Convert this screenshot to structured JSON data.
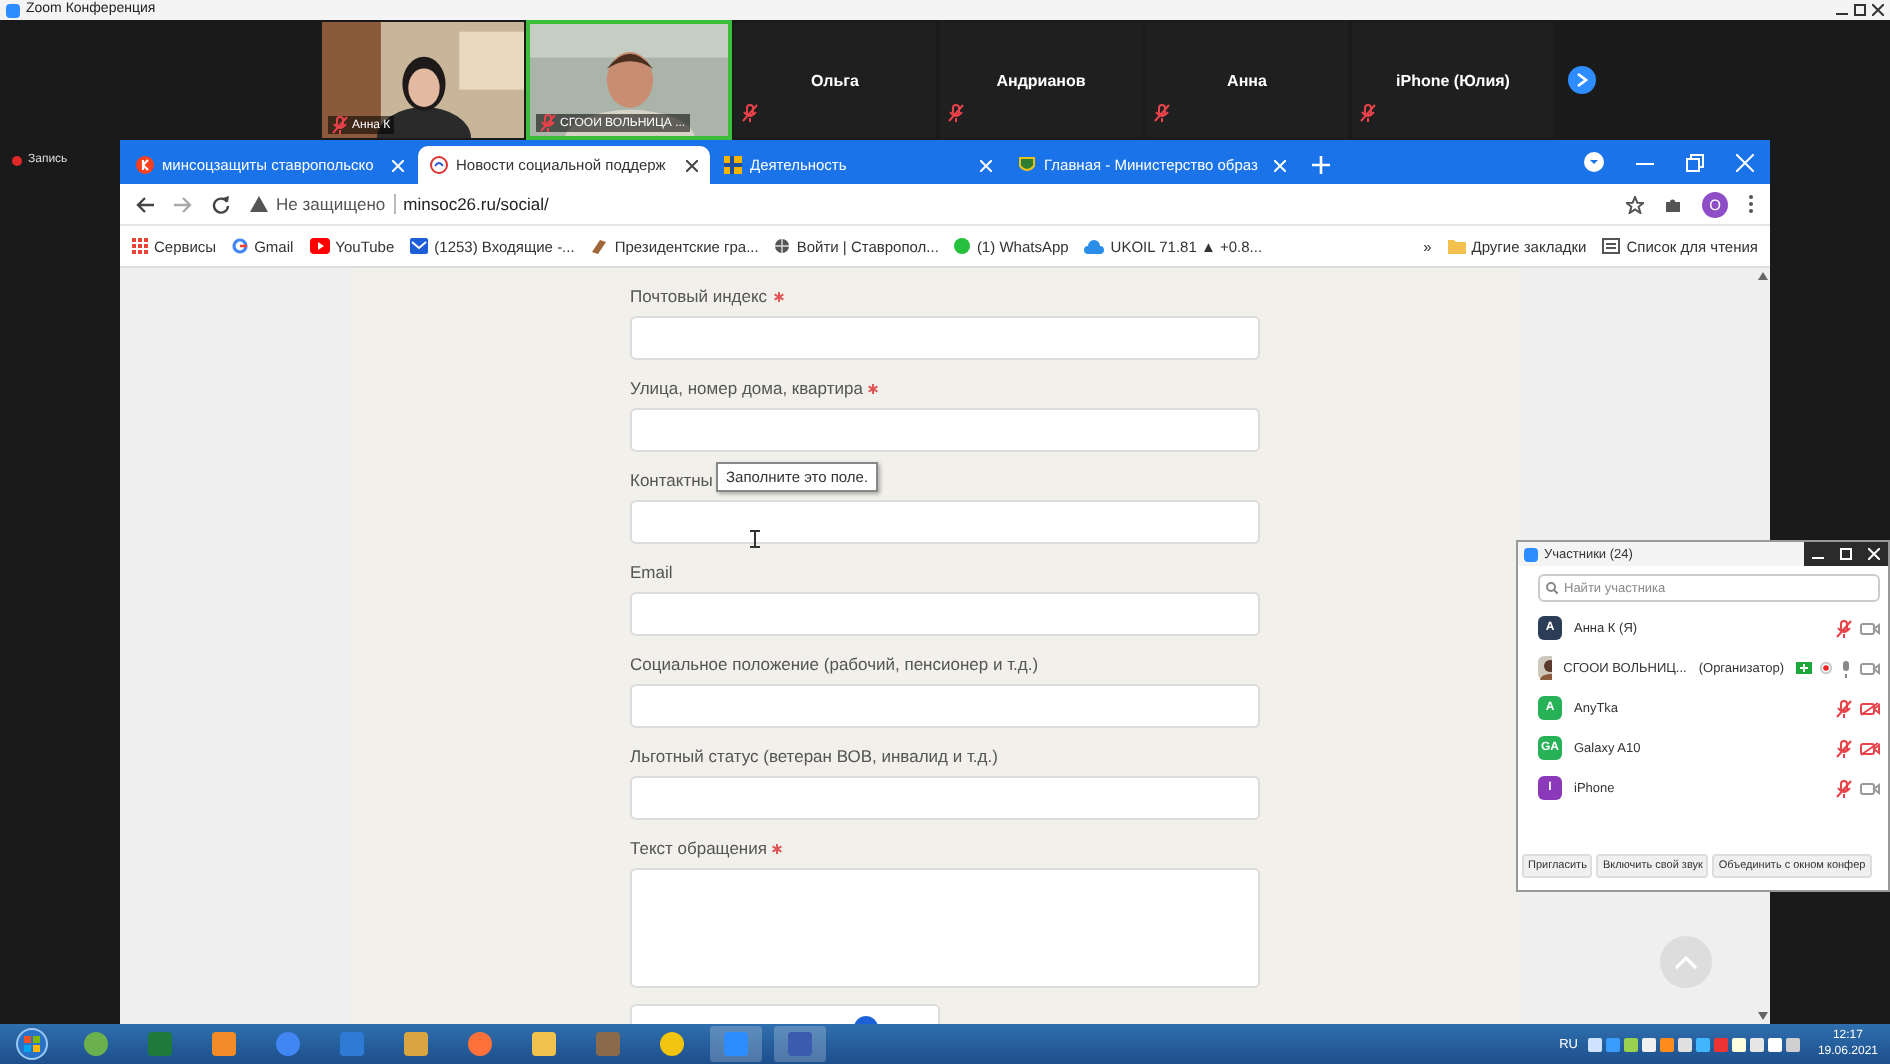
{
  "zoom_window": {
    "title": "Zoom Конференция"
  },
  "video_strip": {
    "tiles": [
      {
        "kind": "video",
        "name": "Анна К",
        "muted": true,
        "speaking": false
      },
      {
        "kind": "video",
        "name": "СГООИ ВОЛЬНИЦА ...",
        "muted": true,
        "speaking": true
      },
      {
        "kind": "name",
        "name": "Ольга",
        "muted": true,
        "speaking": false
      },
      {
        "kind": "name",
        "name": "Андрианов",
        "muted": true,
        "speaking": false
      },
      {
        "kind": "name",
        "name": "Анна",
        "muted": true,
        "speaking": false
      },
      {
        "kind": "name",
        "name": "iPhone (Юлия)",
        "muted": true,
        "speaking": false
      }
    ]
  },
  "recording": {
    "label": "Запись"
  },
  "browser": {
    "tabs": [
      {
        "title": "минсоцзащиты ставропольско",
        "selected": false
      },
      {
        "title": "Новости социальной поддерж",
        "selected": true
      },
      {
        "title": "Деятельность",
        "selected": false
      },
      {
        "title": "Главная - Министерство образ",
        "selected": false
      }
    ],
    "address": {
      "security": "Не защищено",
      "url": "minsoc26.ru/social/"
    },
    "profile_initial": "О",
    "bookmarks": [
      {
        "label": "Сервисы"
      },
      {
        "label": "Gmail"
      },
      {
        "label": "YouTube"
      },
      {
        "label": "(1253) Входящие -..."
      },
      {
        "label": "Президентские гра..."
      },
      {
        "label": "Войти | Ставропол..."
      },
      {
        "label": "(1) WhatsApp"
      },
      {
        "label": "UKOIL 71.81 ▲ +0.8..."
      }
    ],
    "bookmarks_overflow": "»",
    "other_bookmarks": "Другие закладки",
    "reading_list": "Список для чтения"
  },
  "form": {
    "fields": [
      {
        "label": "Почтовый индекс",
        "required": true,
        "kind": "input"
      },
      {
        "label": "Улица, номер дома, квартира",
        "required": true,
        "kind": "input"
      },
      {
        "label": "Контактны",
        "required": false,
        "kind": "input"
      },
      {
        "label": "Email",
        "required": false,
        "kind": "input"
      },
      {
        "label": "Социальное положение (рабочий, пенсионер и т.д.)",
        "required": false,
        "kind": "input"
      },
      {
        "label": "Льготный статус (ветеран ВОВ, инвалид и т.д.)",
        "required": false,
        "kind": "input"
      },
      {
        "label": "Текст обращения",
        "required": true,
        "kind": "textarea"
      }
    ],
    "tooltip": "Заполните это поле."
  },
  "participants": {
    "title": "Участники (24)",
    "search": {
      "placeholder": "Найти участника"
    },
    "items": [
      {
        "kind": "initials",
        "initials": "A",
        "color": "#2c3e57",
        "name": "Анна К (Я)",
        "mic_muted": true,
        "video_off": false,
        "sharing": false,
        "recording": false
      },
      {
        "kind": "picture",
        "name": "СГООИ ВОЛЬНИЦ...",
        "role": "(Организатор)",
        "mic_muted": false,
        "video_off": false,
        "sharing": true,
        "recording": true
      },
      {
        "kind": "initials",
        "initials": "A",
        "color": "#27b257",
        "name": "AnyTka",
        "mic_muted": true,
        "video_off": true,
        "sharing": false,
        "recording": false
      },
      {
        "kind": "initials",
        "initials": "GA",
        "color": "#27b257",
        "name": "Galaxy A10",
        "mic_muted": true,
        "video_off": true,
        "sharing": false,
        "recording": false
      },
      {
        "kind": "initials",
        "initials": "I",
        "color": "#8a3ab8",
        "name": "iPhone",
        "mic_muted": true,
        "video_off": false,
        "sharing": false,
        "recording": false
      }
    ],
    "buttons": [
      "Пригласить",
      "Включить свой звук",
      "Объединить с окном конфер"
    ]
  },
  "taskbar": {
    "language": "RU",
    "time": "12:17",
    "date": "19.06.2021"
  }
}
